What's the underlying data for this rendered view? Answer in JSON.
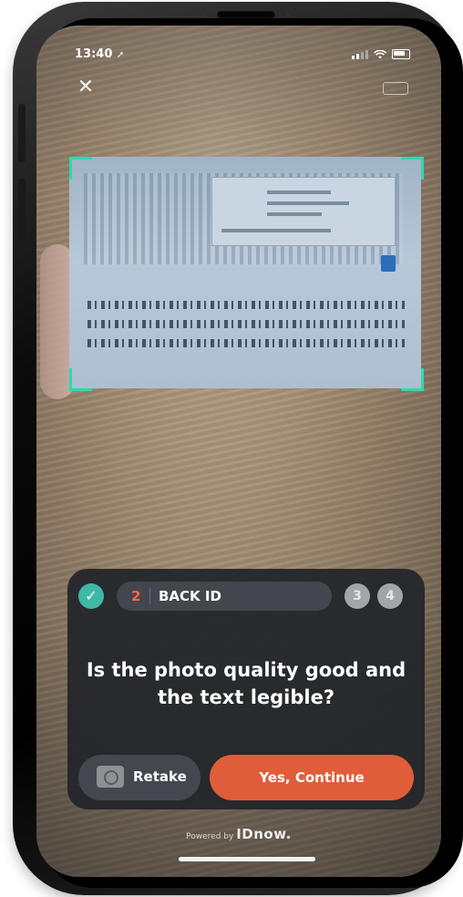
{
  "status_bar": {
    "time": "13:40",
    "location_glyph": "➚"
  },
  "header": {
    "close_glyph": "✕"
  },
  "progress": {
    "done_glyph": "✓",
    "current_step_number": "2",
    "current_step_label": "BACK ID",
    "next_steps": [
      "3",
      "4"
    ]
  },
  "prompt": {
    "question": "Is the photo quality good and the text legible?"
  },
  "actions": {
    "retake_label": "Retake",
    "continue_label": "Yes, Continue"
  },
  "footer": {
    "powered_by": "Powered by",
    "brand": "IDnow."
  },
  "colors": {
    "accent_teal": "#3fb8a5",
    "frame_corner": "#2fd8b0",
    "primary_button": "#e05d3a",
    "step_number": "#ef6a42",
    "panel": "#22252a"
  },
  "icons": {
    "close": "close-icon",
    "flash": "flash-icon",
    "check": "check-icon",
    "camera": "camera-icon"
  }
}
